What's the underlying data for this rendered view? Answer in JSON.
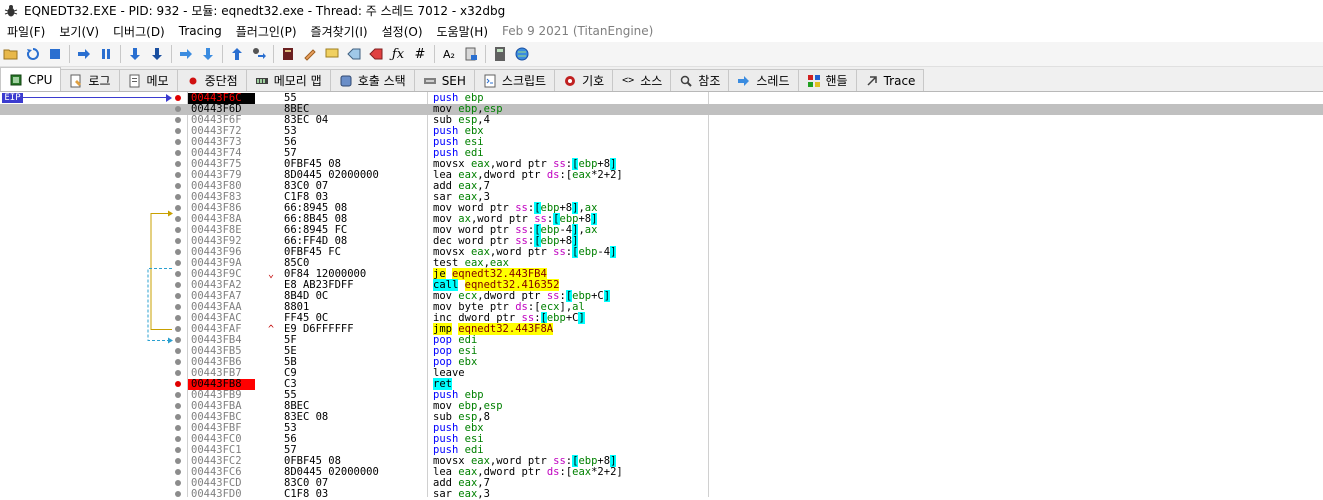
{
  "window": {
    "title": "EQNEDT32.EXE - PID: 932 - 모듈: eqnedt32.exe - Thread: 주 스레드 7012 - x32dbg",
    "icon": "bug-icon"
  },
  "menu": {
    "items": [
      "파일(F)",
      "보기(V)",
      "디버그(D)",
      "Tracing",
      "플러그인(P)",
      "즐겨찾기(I)",
      "설정(O)",
      "도움말(H)"
    ],
    "build_info": "Feb 9 2021 (TitanEngine)"
  },
  "toolbar": {
    "icons": [
      "open-folder-icon",
      "restart-icon",
      "stop-icon",
      "run-icon",
      "pause-icon",
      "step-into-icon",
      "step-over-icon",
      "trace-into-icon",
      "trace-over-icon",
      "execute-till-return-icon",
      "run-to-user-code-icon",
      "script-icon",
      "patch-icon",
      "comment-icon",
      "label-icon",
      "bookmark-icon",
      "function-icon",
      "hash-icon",
      "font-icon",
      "module-icon",
      "calculator-icon",
      "globe-icon"
    ]
  },
  "tabs": [
    {
      "label": "CPU",
      "icon": "cpu-icon",
      "active": true
    },
    {
      "label": "로그",
      "icon": "log-icon",
      "active": false
    },
    {
      "label": "메모",
      "icon": "note-icon",
      "active": false
    },
    {
      "label": "중단점",
      "icon": "breakpoint-icon",
      "active": false
    },
    {
      "label": "메모리 맵",
      "icon": "memory-map-icon",
      "active": false
    },
    {
      "label": "호출 스택",
      "icon": "call-stack-icon",
      "active": false
    },
    {
      "label": "SEH",
      "icon": "seh-icon",
      "active": false
    },
    {
      "label": "스크립트",
      "icon": "script-icon",
      "active": false
    },
    {
      "label": "기호",
      "icon": "symbol-icon",
      "active": false
    },
    {
      "label": "소스",
      "icon": "source-icon",
      "active": false
    },
    {
      "label": "참조",
      "icon": "references-icon",
      "active": false
    },
    {
      "label": "스레드",
      "icon": "threads-icon",
      "active": false
    },
    {
      "label": "핸들",
      "icon": "handles-icon",
      "active": false
    },
    {
      "label": "Trace",
      "icon": "trace-icon",
      "active": false
    }
  ],
  "disassembly": {
    "eip_label": "EIP",
    "rows": [
      {
        "addr": "00443F6C",
        "bytes": "55",
        "asm": "push ebp",
        "state": "eip"
      },
      {
        "addr": "00443F6D",
        "bytes": "8BEC",
        "asm": "mov ebp,esp",
        "state": "selected"
      },
      {
        "addr": "00443F6F",
        "bytes": "83EC 04",
        "asm": "sub esp,4",
        "state": ""
      },
      {
        "addr": "00443F72",
        "bytes": "53",
        "asm": "push ebx",
        "state": ""
      },
      {
        "addr": "00443F73",
        "bytes": "56",
        "asm": "push esi",
        "state": ""
      },
      {
        "addr": "00443F74",
        "bytes": "57",
        "asm": "push edi",
        "state": ""
      },
      {
        "addr": "00443F75",
        "bytes": "0FBF45 08",
        "asm": "movsx eax,word ptr ss:[ebp+8]",
        "state": ""
      },
      {
        "addr": "00443F79",
        "bytes": "8D0445 02000000",
        "asm": "lea eax,dword ptr ds:[eax*2+2]",
        "state": ""
      },
      {
        "addr": "00443F80",
        "bytes": "83C0 07",
        "asm": "add eax,7",
        "state": ""
      },
      {
        "addr": "00443F83",
        "bytes": "C1F8 03",
        "asm": "sar eax,3",
        "state": ""
      },
      {
        "addr": "00443F86",
        "bytes": "66:8945 08",
        "asm": "mov word ptr ss:[ebp+8],ax",
        "state": ""
      },
      {
        "addr": "00443F8A",
        "bytes": "66:8B45 08",
        "asm": "mov ax,word ptr ss:[ebp+8]",
        "state": ""
      },
      {
        "addr": "00443F8E",
        "bytes": "66:8945 FC",
        "asm": "mov word ptr ss:[ebp-4],ax",
        "state": ""
      },
      {
        "addr": "00443F92",
        "bytes": "66:FF4D 08",
        "asm": "dec word ptr ss:[ebp+8]",
        "state": ""
      },
      {
        "addr": "00443F96",
        "bytes": "0FBF45 FC",
        "asm": "movsx eax,word ptr ss:[ebp-4]",
        "state": ""
      },
      {
        "addr": "00443F9A",
        "bytes": "85C0",
        "asm": "test eax,eax",
        "state": ""
      },
      {
        "addr": "00443F9C",
        "bytes": "0F84 12000000",
        "asm": "je eqnedt32.443FB4",
        "state": "",
        "mark": "⌄"
      },
      {
        "addr": "00443FA2",
        "bytes": "E8 AB23FDFF",
        "asm": "call eqnedt32.416352",
        "state": ""
      },
      {
        "addr": "00443FA7",
        "bytes": "8B4D 0C",
        "asm": "mov ecx,dword ptr ss:[ebp+C]",
        "state": ""
      },
      {
        "addr": "00443FAA",
        "bytes": "8801",
        "asm": "mov byte ptr ds:[ecx],al",
        "state": ""
      },
      {
        "addr": "00443FAC",
        "bytes": "FF45 0C",
        "asm": "inc dword ptr ss:[ebp+C]",
        "state": ""
      },
      {
        "addr": "00443FAF",
        "bytes": "E9 D6FFFFFF",
        "asm": "jmp eqnedt32.443F8A",
        "state": "",
        "mark": "^"
      },
      {
        "addr": "00443FB4",
        "bytes": "5F",
        "asm": "pop edi",
        "state": ""
      },
      {
        "addr": "00443FB5",
        "bytes": "5E",
        "asm": "pop esi",
        "state": ""
      },
      {
        "addr": "00443FB6",
        "bytes": "5B",
        "asm": "pop ebx",
        "state": ""
      },
      {
        "addr": "00443FB7",
        "bytes": "C9",
        "asm": "leave",
        "state": ""
      },
      {
        "addr": "00443FB8",
        "bytes": "C3",
        "asm": "ret",
        "state": "bp"
      },
      {
        "addr": "00443FB9",
        "bytes": "55",
        "asm": "push ebp",
        "state": ""
      },
      {
        "addr": "00443FBA",
        "bytes": "8BEC",
        "asm": "mov ebp,esp",
        "state": ""
      },
      {
        "addr": "00443FBC",
        "bytes": "83EC 08",
        "asm": "sub esp,8",
        "state": ""
      },
      {
        "addr": "00443FBF",
        "bytes": "53",
        "asm": "push ebx",
        "state": ""
      },
      {
        "addr": "00443FC0",
        "bytes": "56",
        "asm": "push esi",
        "state": ""
      },
      {
        "addr": "00443FC1",
        "bytes": "57",
        "asm": "push edi",
        "state": ""
      },
      {
        "addr": "00443FC2",
        "bytes": "0FBF45 08",
        "asm": "movsx eax,word ptr ss:[ebp+8]",
        "state": ""
      },
      {
        "addr": "00443FC6",
        "bytes": "8D0445 02000000",
        "asm": "lea eax,dword ptr ds:[eax*2+2]",
        "state": ""
      },
      {
        "addr": "00443FCD",
        "bytes": "83C0 07",
        "asm": "add eax,7",
        "state": ""
      },
      {
        "addr": "00443FD0",
        "bytes": "C1F8 03",
        "asm": "sar eax,3",
        "state": ""
      }
    ]
  },
  "colors": {
    "eip_arrow": "#3b3bcf",
    "breakpoint": "#ff0000",
    "jump_highlight": "#ffff00",
    "call_highlight": "#00ffff",
    "selected_row": "#c0c0c0"
  }
}
